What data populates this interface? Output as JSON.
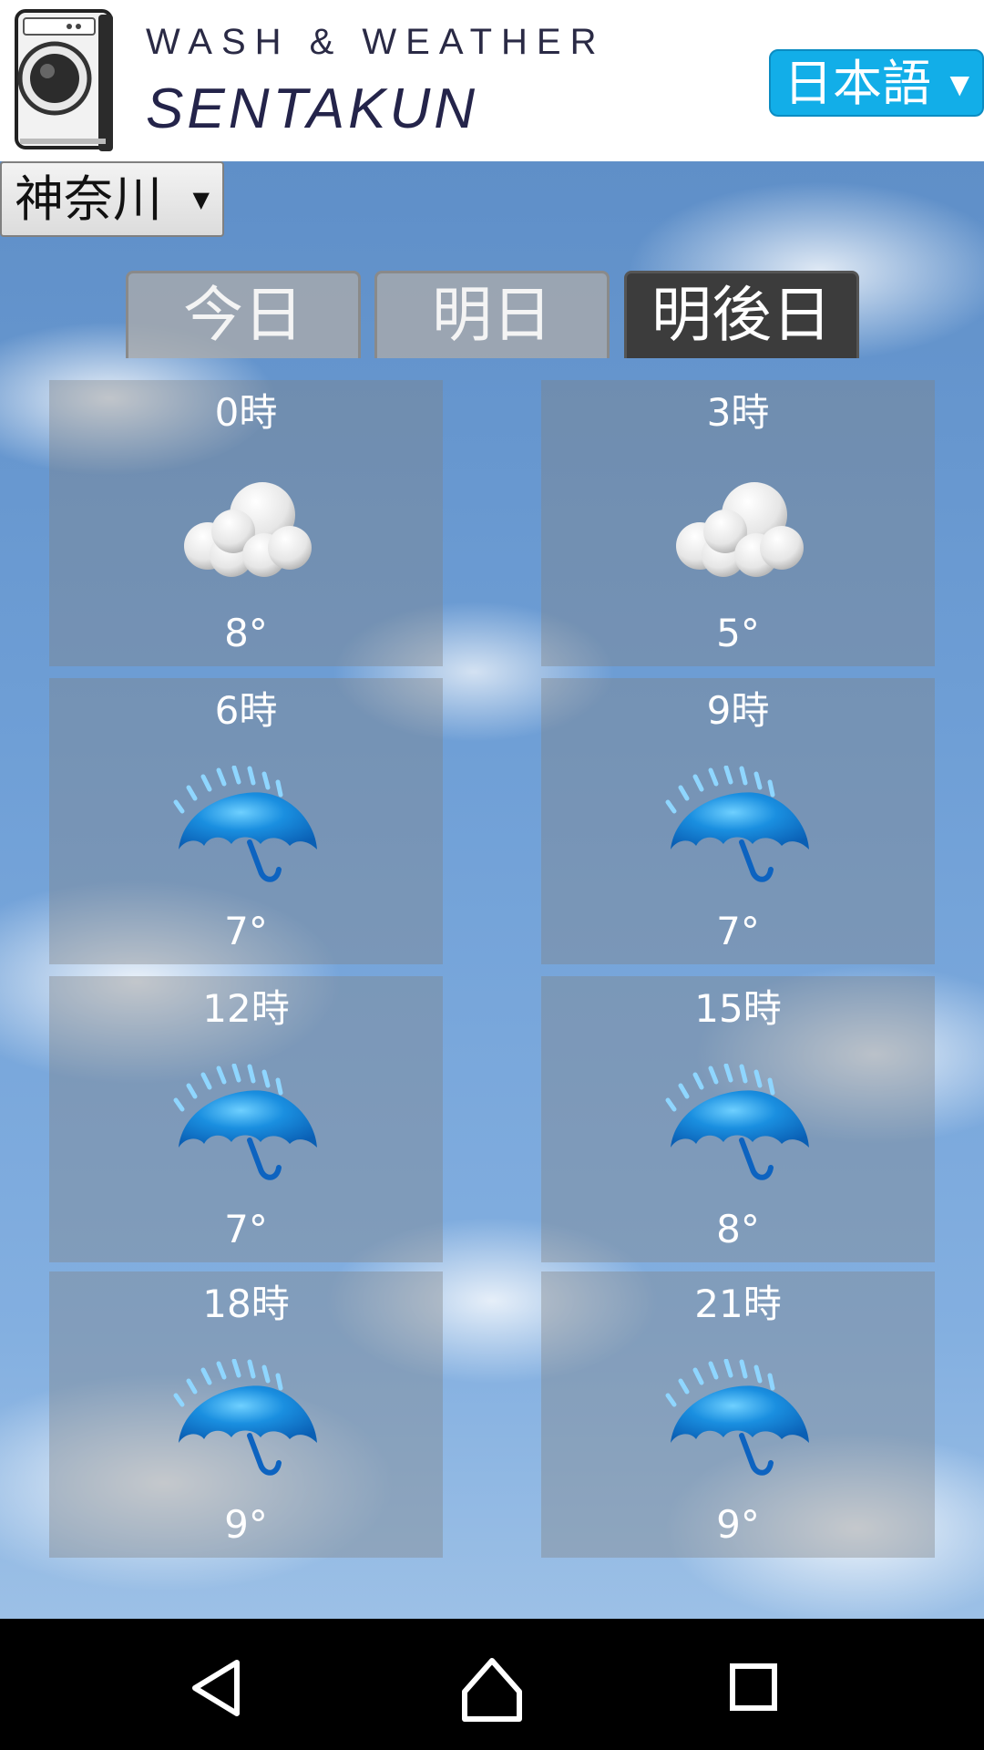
{
  "header": {
    "brand_line1": "WASH & WEATHER",
    "brand_line2": "SENTAKUN",
    "language": {
      "selected": "日本語",
      "caret": "▼"
    }
  },
  "prefecture": {
    "selected": "神奈川",
    "caret": "▼"
  },
  "day_tabs": [
    {
      "label": "今日",
      "active": false
    },
    {
      "label": "明日",
      "active": false
    },
    {
      "label": "明後日",
      "active": true
    }
  ],
  "forecast": [
    {
      "time": "0時",
      "icon": "cloud-icon",
      "temp": "8°"
    },
    {
      "time": "3時",
      "icon": "cloud-icon",
      "temp": "5°"
    },
    {
      "time": "6時",
      "icon": "umbrella-rain-icon",
      "temp": "7°"
    },
    {
      "time": "9時",
      "icon": "umbrella-rain-icon",
      "temp": "7°"
    },
    {
      "time": "12時",
      "icon": "umbrella-rain-icon",
      "temp": "7°"
    },
    {
      "time": "15時",
      "icon": "umbrella-rain-icon",
      "temp": "8°"
    },
    {
      "time": "18時",
      "icon": "umbrella-rain-icon",
      "temp": "9°"
    },
    {
      "time": "21時",
      "icon": "umbrella-rain-icon",
      "temp": "9°"
    }
  ],
  "colors": {
    "language_button": "#12aee8",
    "active_tab": "#3c3c3c",
    "umbrella": "#1477cc"
  }
}
